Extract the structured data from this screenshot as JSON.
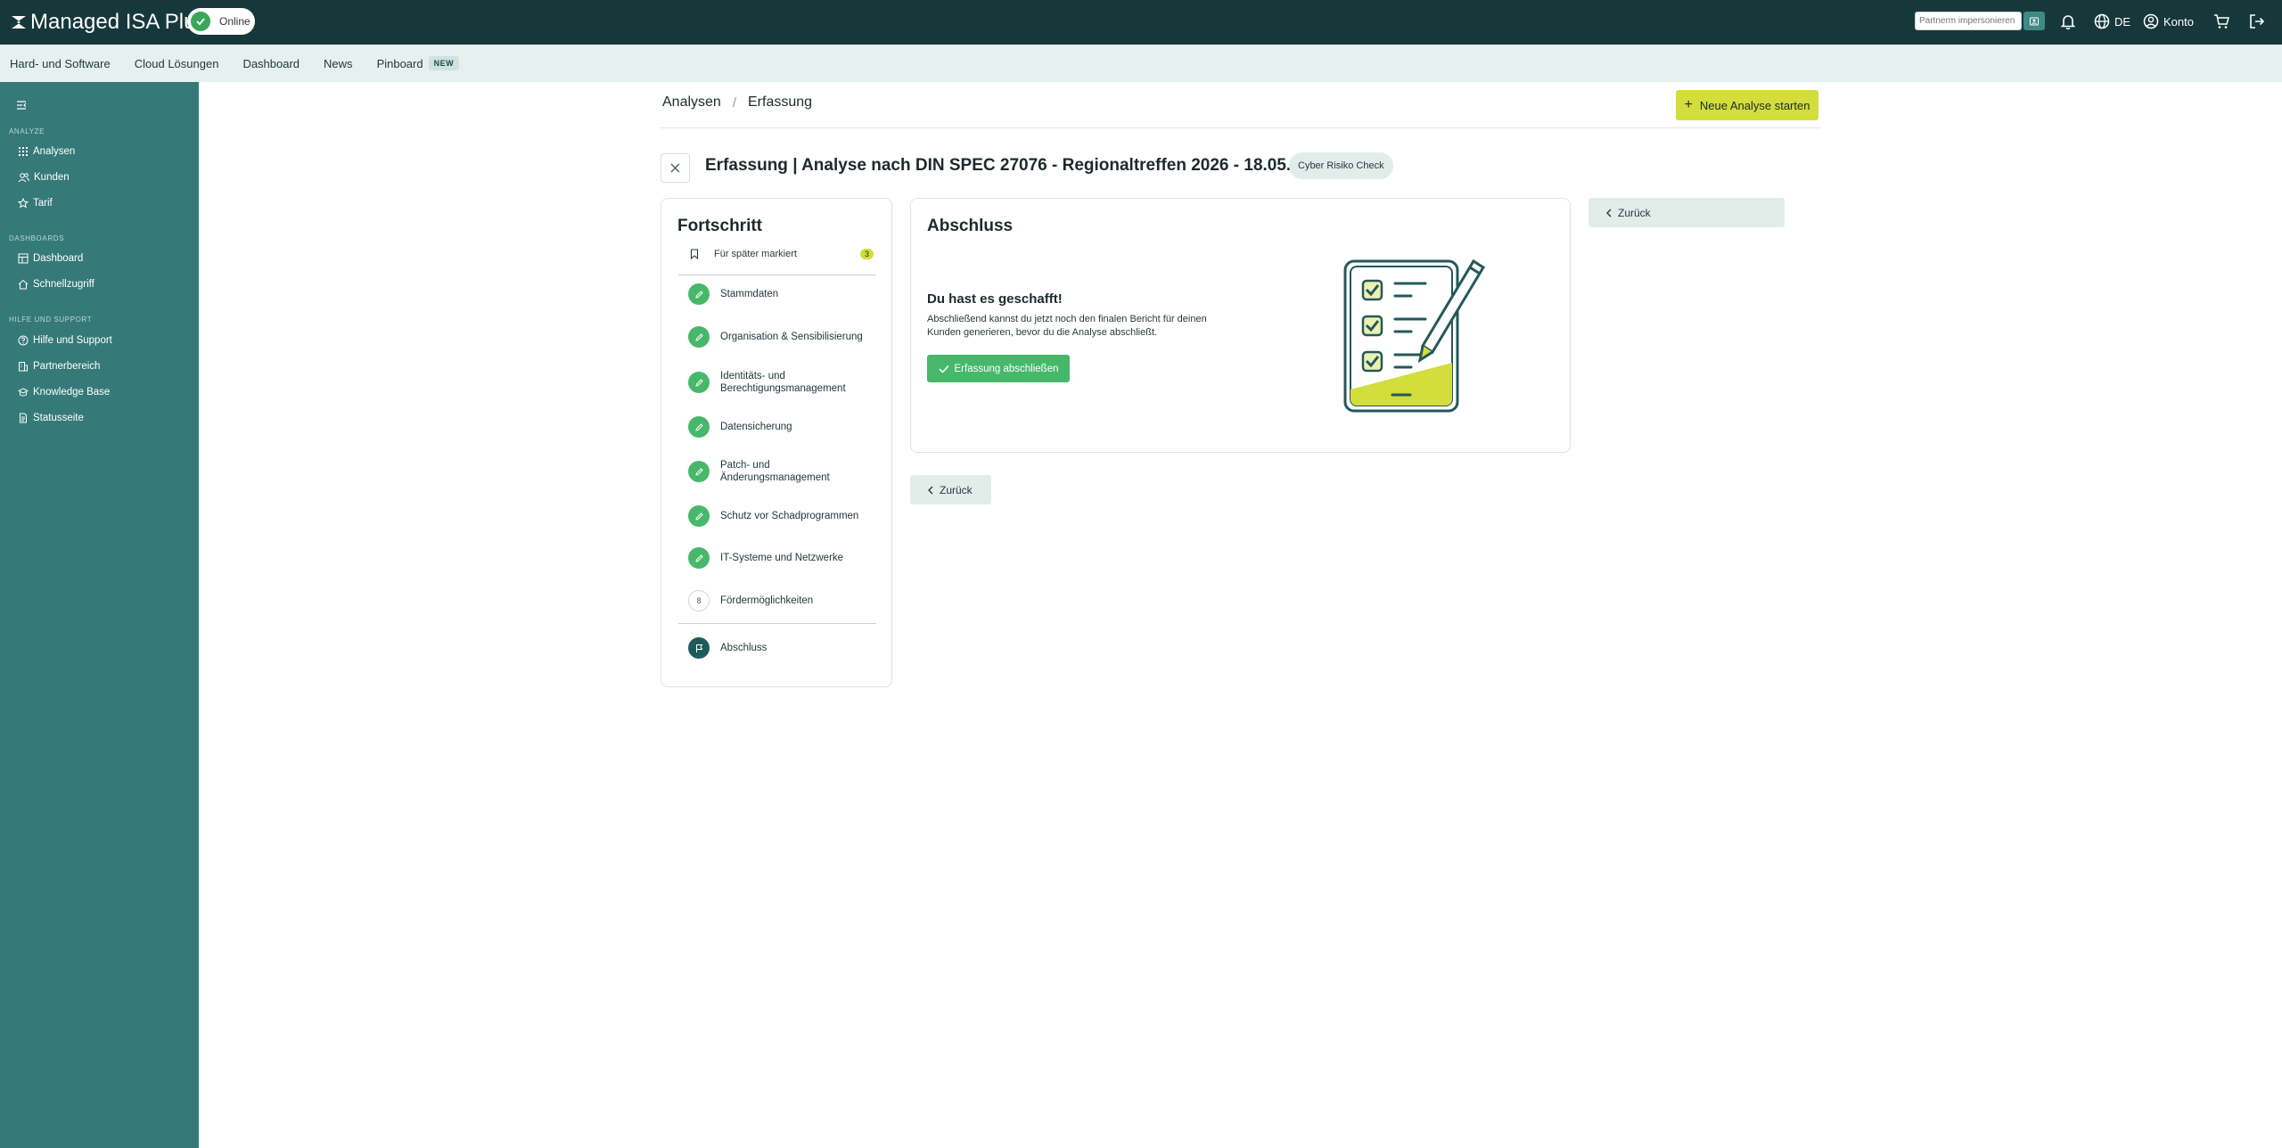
{
  "header": {
    "app_title": "Managed ISA Plus",
    "status": "Online",
    "impersonate_placeholder": "Partnerm impersonieren",
    "language": "DE",
    "account": "Konto"
  },
  "nav": {
    "items": [
      {
        "label": "Hard- und Software"
      },
      {
        "label": "Cloud Lösungen"
      },
      {
        "label": "Dashboard"
      },
      {
        "label": "News"
      },
      {
        "label": "Pinboard",
        "badge": "NEW"
      }
    ]
  },
  "sidebar": {
    "section_analyse": "ANALYZE",
    "analyse_items": [
      {
        "label": "Analysen",
        "icon": "grid-icon"
      },
      {
        "label": "Kunden",
        "icon": "users-icon"
      },
      {
        "label": "Tarif",
        "icon": "star-icon"
      }
    ],
    "section_dashboards": "DASHBOARDS",
    "dashboard_items": [
      {
        "label": "Dashboard",
        "icon": "dashboard-icon"
      },
      {
        "label": "Schnellzugriff",
        "icon": "home-icon"
      }
    ],
    "section_help": "HILFE UND SUPPORT",
    "help_items": [
      {
        "label": "Hilfe und Support",
        "icon": "help-icon"
      },
      {
        "label": "Partnerbereich",
        "icon": "building-icon"
      },
      {
        "label": "Knowledge Base",
        "icon": "book-icon"
      },
      {
        "label": "Statusseite",
        "icon": "document-icon"
      }
    ]
  },
  "breadcrumb": {
    "root": "Analysen",
    "separator": "/",
    "current": "Erfassung"
  },
  "actions": {
    "new_analysis": "Neue Analyse starten",
    "back": "Zurück"
  },
  "page": {
    "title": "Erfassung | Analyse nach DIN SPEC 27076 - Regionaltreffen 2026 - 18.05.2026",
    "badge": "Cyber Risiko Check"
  },
  "progress": {
    "title": "Fortschritt",
    "marked_label": "Für später markiert",
    "marked_count": "3",
    "steps": [
      {
        "label": "Stammdaten",
        "state": "done"
      },
      {
        "label": "Organisation & Sensibilisierung",
        "state": "done"
      },
      {
        "label": "Identitäts- und Berechtigungsmanagement",
        "state": "done"
      },
      {
        "label": "Datensicherung",
        "state": "done"
      },
      {
        "label": "Patch- und Änderungsmanagement",
        "state": "done"
      },
      {
        "label": "Schutz vor Schadprogrammen",
        "state": "done"
      },
      {
        "label": "IT-Systeme und Netzwerke",
        "state": "done"
      },
      {
        "label": "Fördermöglichkeiten",
        "state": "open",
        "number": "8"
      }
    ],
    "final_step": "Abschluss"
  },
  "final": {
    "title": "Abschluss",
    "heading": "Du hast es geschafft!",
    "text": "Abschließend kannst du jetzt noch den finalen Bericht für deinen Kunden generieren, bevor du die Analyse abschließt.",
    "button": "Erfassung abschließen"
  },
  "colors": {
    "topbar": "#17383b",
    "sidebar": "#357a78",
    "accent_yellow": "#d3dd3b",
    "success_green": "#47b86a"
  }
}
